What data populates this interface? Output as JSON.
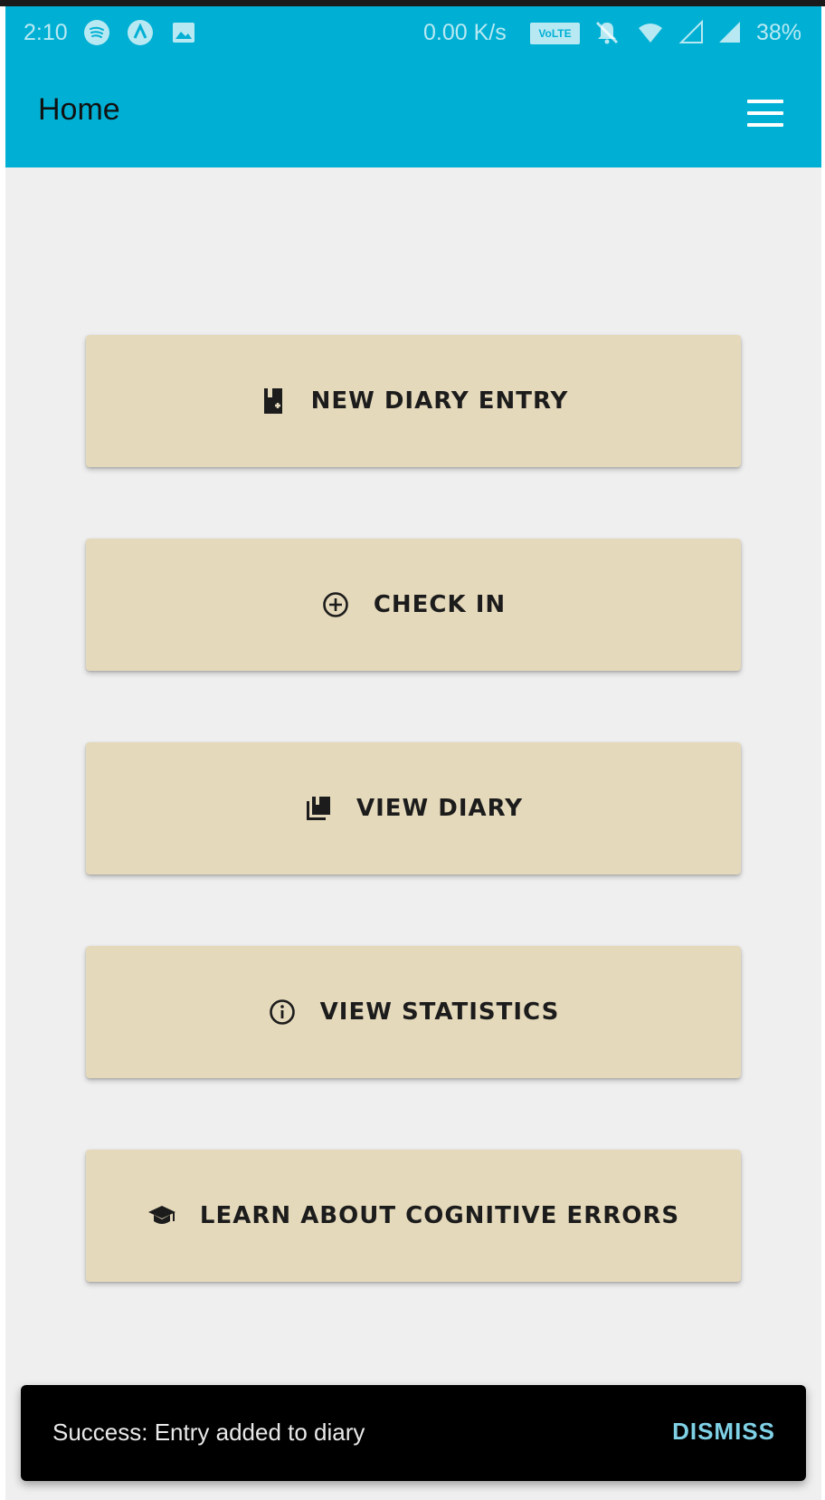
{
  "status_bar": {
    "time": "2:10",
    "network_speed": "0.00 K/s",
    "volte": "VoLTE",
    "battery": "38%",
    "icons": [
      "spotify-icon",
      "app-icon",
      "gallery-icon",
      "volte-icon",
      "bell-off-icon",
      "wifi-icon",
      "signal-empty-icon",
      "signal-icon"
    ]
  },
  "app_bar": {
    "title": "Home",
    "menu_icon": "hamburger-menu-icon",
    "background_color": "#00b0d4"
  },
  "menu": {
    "button_color": "#e5d9bb",
    "buttons": [
      {
        "label": "NEW DIARY ENTRY",
        "icon": "book-add-icon"
      },
      {
        "label": "CHECK IN",
        "icon": "plus-circle-icon"
      },
      {
        "label": "VIEW DIARY",
        "icon": "library-books-icon"
      },
      {
        "label": "VIEW STATISTICS",
        "icon": "info-circle-icon"
      },
      {
        "label": "LEARN ABOUT COGNITIVE ERRORS",
        "icon": "graduation-cap-icon"
      }
    ]
  },
  "snackbar": {
    "message": "Success: Entry added to diary",
    "action": "DISMISS",
    "action_color": "#7fd1e6"
  }
}
